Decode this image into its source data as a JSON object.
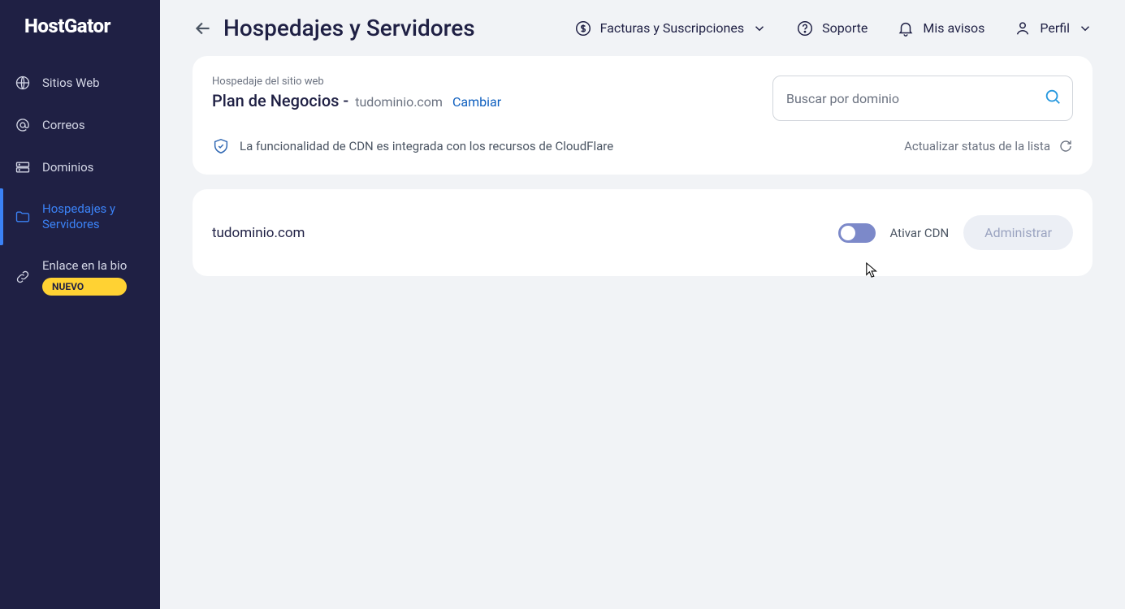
{
  "brand": "HostGator",
  "sidebar": {
    "items": [
      {
        "label": "Sitios Web"
      },
      {
        "label": "Correos"
      },
      {
        "label": "Dominios"
      },
      {
        "label": "Hospedajes y Servidores"
      },
      {
        "label": "Enlace en la bio",
        "badge": "NUEVO"
      }
    ]
  },
  "header": {
    "title": "Hospedajes y Servidores",
    "links": {
      "billing": "Facturas y Suscripciones",
      "support": "Soporte",
      "notices": "Mis avisos",
      "profile": "Perfil"
    }
  },
  "card": {
    "kicker": "Hospedaje del sitio web",
    "plan_name": "Plan de Negocios -",
    "plan_domain": "tudominio.com",
    "change": "Cambiar",
    "search_placeholder": "Buscar por dominio",
    "info": "La funcionalidad de CDN es integrada con los recursos de CloudFlare",
    "refresh": "Actualizar status de la lista"
  },
  "row": {
    "domain": "tudominio.com",
    "toggle_label": "Ativar CDN",
    "manage": "Administrar"
  }
}
